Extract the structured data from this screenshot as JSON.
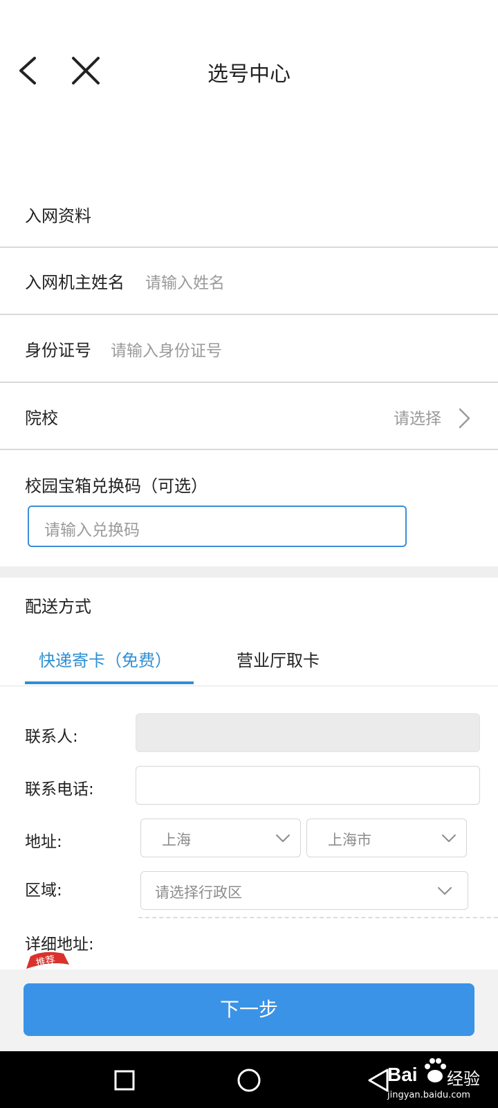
{
  "header": {
    "title": "选号中心"
  },
  "sections": {
    "network_info": "入网资料",
    "delivery": "配送方式"
  },
  "rows": {
    "name_label": "入网机主姓名",
    "name_placeholder": "请输入姓名",
    "id_label": "身份证号",
    "id_placeholder": "请输入身份证号",
    "school_label": "院校",
    "school_value": "请选择",
    "coupon_label": "校园宝箱兑换码（可选）",
    "coupon_placeholder": "请输入兑换码"
  },
  "tabs": [
    {
      "label": "快递寄卡（免费）",
      "active": true
    },
    {
      "label": "营业厅取卡",
      "active": false
    }
  ],
  "form": {
    "contact_label": "联系人:",
    "phone_label": "联系电话:",
    "address_label": "地址:",
    "province": "上海",
    "city": "上海市",
    "district_label": "区域:",
    "district_placeholder": "请选择行政区",
    "detail_label": "详细地址:",
    "badge": "推荐"
  },
  "next_button": "下一步",
  "watermark": {
    "brand": "Bai",
    "suffix": "经验",
    "url": "jingyan.baidu.com"
  },
  "colors": {
    "accent": "#2f8fd3",
    "button": "#3a93e6",
    "navbar": "#000000"
  },
  "icons": [
    "back-icon",
    "close-icon",
    "chevron-right-icon",
    "chevron-down-icon",
    "nav-recents-icon",
    "nav-home-icon",
    "nav-back-icon"
  ]
}
